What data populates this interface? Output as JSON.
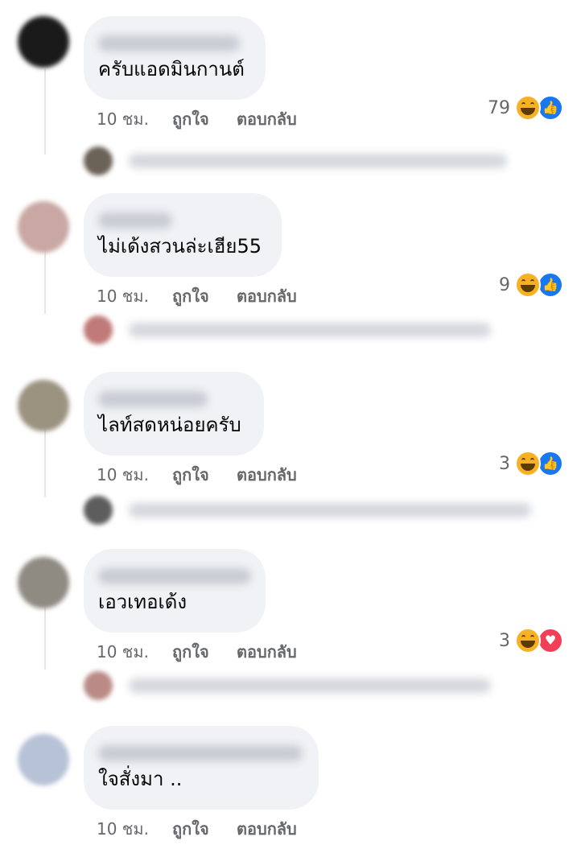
{
  "comments": [
    {
      "text": "ครับแอดมินกานต์",
      "time": "10 ชม.",
      "like_label": "ถูกใจ",
      "reply_label": "ตอบกลับ",
      "reaction_count": "79",
      "reactions": [
        "haha-icon",
        "like-icon"
      ],
      "avatar_color": "#1a1a1a"
    },
    {
      "text": "ไม่เด้งสวนล่ะเฮีย55",
      "time": "10 ชม.",
      "like_label": "ถูกใจ",
      "reply_label": "ตอบกลับ",
      "reaction_count": "9",
      "reactions": [
        "haha-icon",
        "like-icon"
      ],
      "avatar_color": "#c9a7a3"
    },
    {
      "text": "ไลท์สดหน่อยครับ",
      "time": "10 ชม.",
      "like_label": "ถูกใจ",
      "reply_label": "ตอบกลับ",
      "reaction_count": "3",
      "reactions": [
        "haha-icon",
        "like-icon"
      ],
      "avatar_color": "#9b9280"
    },
    {
      "text": "เอวเทอเด้ง",
      "time": "10 ชม.",
      "like_label": "ถูกใจ",
      "reply_label": "ตอบกลับ",
      "reaction_count": "3",
      "reactions": [
        "haha-icon",
        "love-icon"
      ],
      "avatar_color": "#8f8a82"
    },
    {
      "text": "ใจสั่งมา ..",
      "time": "10 ชม.",
      "like_label": "ถูกใจ",
      "reply_label": "ตอบกลับ",
      "reaction_count": "",
      "reactions": [],
      "avatar_color": "#b7c2d6"
    }
  ],
  "reply_avatar_colors": [
    "#6b6258",
    "#c07a78",
    "#5d5d5d",
    "#b98a86"
  ],
  "colors": {
    "bubble": "#f0f2f5",
    "meta_text": "#65676b",
    "like_blue": "#1877f2",
    "love_red": "#f33e58",
    "haha_yellow": "#f7b125"
  }
}
